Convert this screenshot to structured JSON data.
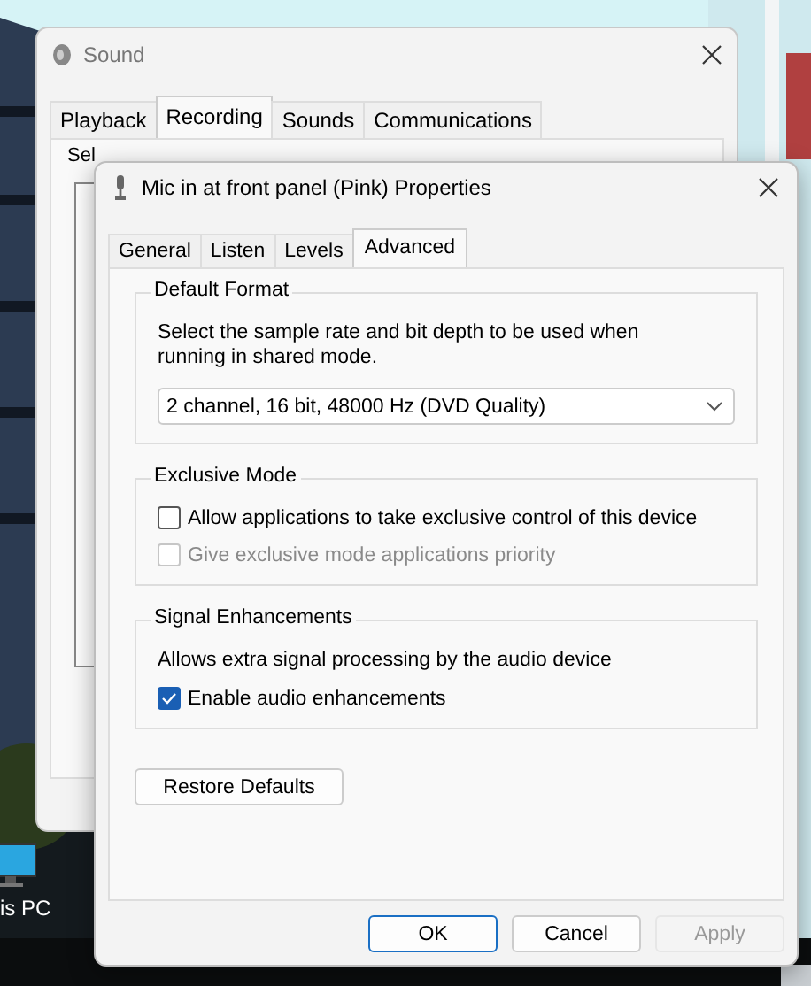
{
  "desktop": {
    "icon_label": "is PC"
  },
  "sound_window": {
    "title": "Sound",
    "instruction": "Sel",
    "tabs": [
      {
        "label": "Playback",
        "selected": false
      },
      {
        "label": "Recording",
        "selected": true
      },
      {
        "label": "Sounds",
        "selected": false
      },
      {
        "label": "Communications",
        "selected": false
      }
    ]
  },
  "properties_dialog": {
    "title": "Mic in at front panel (Pink) Properties",
    "tabs": [
      {
        "label": "General",
        "selected": false
      },
      {
        "label": "Listen",
        "selected": false
      },
      {
        "label": "Levels",
        "selected": false
      },
      {
        "label": "Advanced",
        "selected": true
      }
    ],
    "groups": [
      {
        "title": "Default Format",
        "description": "Select the sample rate and bit depth to be used when running in shared mode.",
        "dropdown": {
          "value": "2 channel, 16 bit, 48000 Hz (DVD Quality)"
        }
      },
      {
        "title": "Exclusive Mode",
        "checkboxes": [
          {
            "label": "Allow applications to take exclusive control of this device",
            "checked": false,
            "disabled": false
          },
          {
            "label": "Give exclusive mode applications priority",
            "checked": false,
            "disabled": true
          }
        ]
      },
      {
        "title": "Signal Enhancements",
        "description": "Allows extra signal processing by the audio device",
        "checkboxes": [
          {
            "label": "Enable audio enhancements",
            "checked": true,
            "disabled": false
          }
        ]
      }
    ],
    "restore_button": "Restore Defaults",
    "buttons": [
      {
        "label": "OK",
        "default": true,
        "disabled": false
      },
      {
        "label": "Cancel",
        "default": false,
        "disabled": false
      },
      {
        "label": "Apply",
        "default": false,
        "disabled": true
      }
    ]
  }
}
